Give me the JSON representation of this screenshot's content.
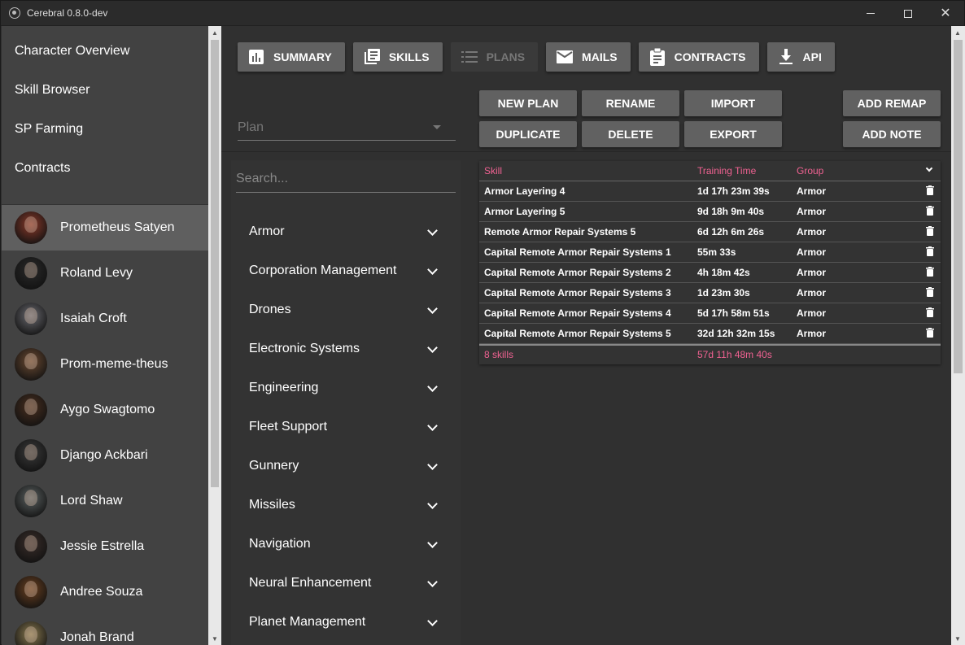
{
  "window": {
    "title": "Cerebral 0.8.0-dev"
  },
  "sidebar": {
    "nav": [
      {
        "label": "Character Overview"
      },
      {
        "label": "Skill Browser"
      },
      {
        "label": "SP Farming"
      },
      {
        "label": "Contracts"
      }
    ],
    "characters": [
      {
        "name": "Prometheus Satyen",
        "active": true,
        "color": "#8a3a2a"
      },
      {
        "name": "Roland Levy",
        "color": "#2a2a2a"
      },
      {
        "name": "Isaiah Croft",
        "color": "#6a6a70"
      },
      {
        "name": "Prom-meme-theus",
        "color": "#6b4a32"
      },
      {
        "name": "Aygo Swagtomo",
        "color": "#4a3020"
      },
      {
        "name": "Django Ackbari",
        "color": "#3a3a3a"
      },
      {
        "name": "Lord Shaw",
        "color": "#5a6060"
      },
      {
        "name": "Jessie Estrella",
        "color": "#3a2e2a"
      },
      {
        "name": "Andree Souza",
        "color": "#6a4020"
      },
      {
        "name": "Jonah Brand",
        "color": "#8a7a50"
      }
    ]
  },
  "tabs": [
    {
      "label": "SUMMARY",
      "icon": "bar-chart-icon"
    },
    {
      "label": "SKILLS",
      "icon": "library-books-icon"
    },
    {
      "label": "PLANS",
      "icon": "list-icon",
      "disabled": true
    },
    {
      "label": "MAILS",
      "icon": "mail-icon"
    },
    {
      "label": "CONTRACTS",
      "icon": "clipboard-icon"
    },
    {
      "label": "API",
      "icon": "download-icon"
    }
  ],
  "plan_select": {
    "placeholder": "Plan"
  },
  "actions": {
    "new_plan": "NEW PLAN",
    "rename": "RENAME",
    "import": "IMPORT",
    "duplicate": "DUPLICATE",
    "delete": "DELETE",
    "export": "EXPORT",
    "add_remap": "ADD REMAP",
    "add_note": "ADD NOTE"
  },
  "browser": {
    "search_placeholder": "Search...",
    "categories": [
      "Armor",
      "Corporation Management",
      "Drones",
      "Electronic Systems",
      "Engineering",
      "Fleet Support",
      "Gunnery",
      "Missiles",
      "Navigation",
      "Neural Enhancement",
      "Planet Management"
    ]
  },
  "plan_table": {
    "headers": {
      "skill": "Skill",
      "time": "Training Time",
      "group": "Group"
    },
    "rows": [
      {
        "skill": "Armor Layering 4",
        "time": "1d 17h 23m 39s",
        "group": "Armor"
      },
      {
        "skill": "Armor Layering 5",
        "time": "9d 18h 9m 40s",
        "group": "Armor"
      },
      {
        "skill": "Remote Armor Repair Systems 5",
        "time": "6d 12h 6m 26s",
        "group": "Armor"
      },
      {
        "skill": "Capital Remote Armor Repair Systems 1",
        "time": "55m 33s",
        "group": "Armor"
      },
      {
        "skill": "Capital Remote Armor Repair Systems 2",
        "time": "4h 18m 42s",
        "group": "Armor"
      },
      {
        "skill": "Capital Remote Armor Repair Systems 3",
        "time": "1d 23m 30s",
        "group": "Armor"
      },
      {
        "skill": "Capital Remote Armor Repair Systems 4",
        "time": "5d 17h 58m 51s",
        "group": "Armor"
      },
      {
        "skill": "Capital Remote Armor Repair Systems 5",
        "time": "32d 12h 32m 15s",
        "group": "Armor"
      }
    ],
    "footer": {
      "count": "8 skills",
      "total": "57d 11h 48m 40s"
    },
    "accent": "#f06292"
  }
}
